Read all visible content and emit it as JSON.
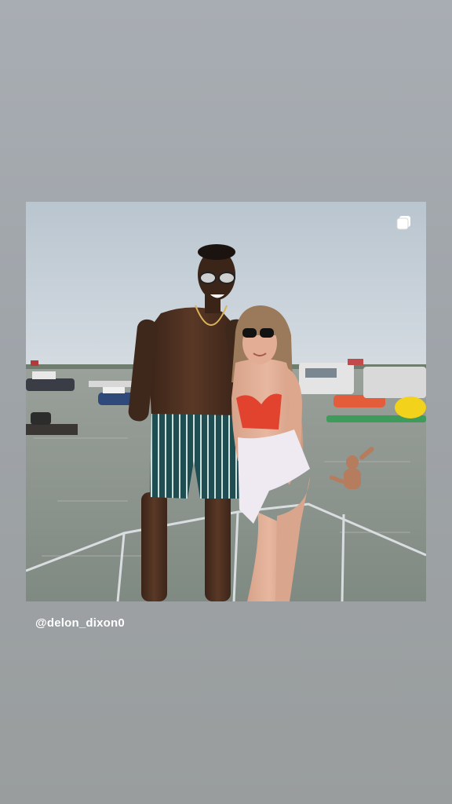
{
  "story": {
    "background_colors": [
      "#a8adb3",
      "#999d9d"
    ]
  },
  "post": {
    "media_type_icon": "carousel-icon",
    "photo_description_icon": "photo"
  },
  "caption": {
    "handle": "@delon_dixon0"
  }
}
